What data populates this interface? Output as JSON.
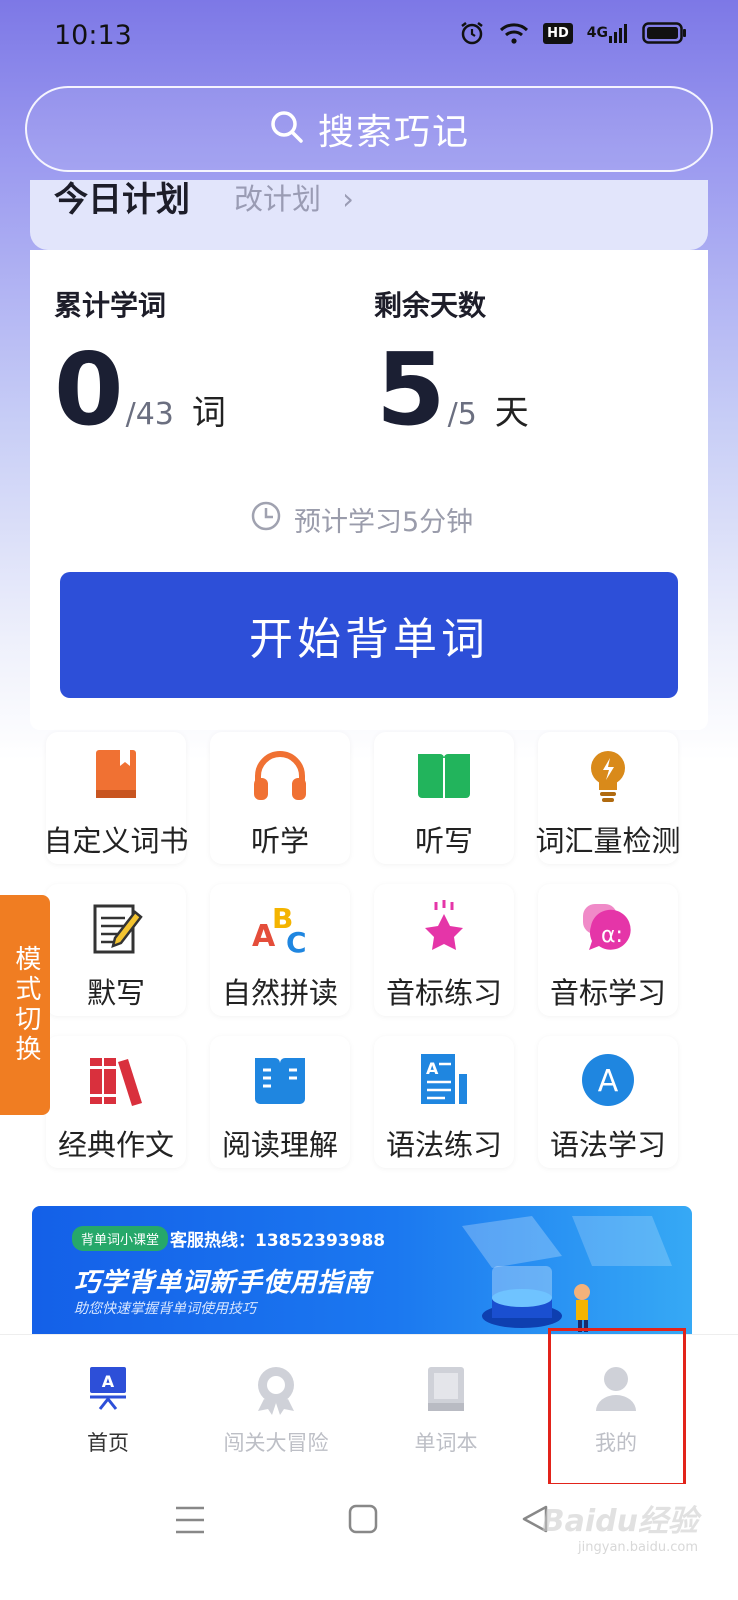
{
  "status_bar": {
    "time": "10:13",
    "hd_label": "HD",
    "network_label": "4G"
  },
  "search": {
    "placeholder": "搜索巧记"
  },
  "plan": {
    "title": "今日计划",
    "edit_label": "改计划"
  },
  "stats": {
    "words": {
      "label": "累计学词",
      "value": "0",
      "total": "/43",
      "unit": "词"
    },
    "days": {
      "label": "剩余天数",
      "value": "5",
      "total": "/5",
      "unit": "天"
    }
  },
  "eta_text": "预计学习5分钟",
  "start_button": "开始背单词",
  "features": [
    {
      "label": "自定义词书",
      "icon": "book-icon",
      "color": "#f07133"
    },
    {
      "label": "听学",
      "icon": "headphones-icon",
      "color": "#f07133"
    },
    {
      "label": "听写",
      "icon": "open-book-icon",
      "color": "#22b45c"
    },
    {
      "label": "词汇量检测",
      "icon": "lightbulb-icon",
      "color": "#d98a1a"
    },
    {
      "label": "默写",
      "icon": "notepad-pen-icon",
      "color": "#333333"
    },
    {
      "label": "自然拼读",
      "icon": "abc-blocks-icon",
      "color": "#e44d3a"
    },
    {
      "label": "音标练习",
      "icon": "star-icon",
      "color": "#e535a8"
    },
    {
      "label": "音标学习",
      "icon": "speech-bubble-icon",
      "color": "#e535a8"
    },
    {
      "label": "经典作文",
      "icon": "books-stack-icon",
      "color": "#d9303d"
    },
    {
      "label": "阅读理解",
      "icon": "reading-book-icon",
      "color": "#1f86e0"
    },
    {
      "label": "语法练习",
      "icon": "document-icon",
      "color": "#1f86e0"
    },
    {
      "label": "语法学习",
      "icon": "letter-a-icon",
      "color": "#1f86e0",
      "glyph": "A"
    }
  ],
  "mode_switch": "模式切换",
  "banner": {
    "tag": "背单词小课堂",
    "hotline": "客服热线：13852393988",
    "title": "巧学背单词新手使用指南",
    "subtitle": "助您快速掌握背单词使用技巧"
  },
  "bottom_nav": [
    {
      "label": "首页",
      "icon": "home-icon",
      "active": true,
      "glyph": "A"
    },
    {
      "label": "闯关大冒险",
      "icon": "medal-icon",
      "active": false
    },
    {
      "label": "单词本",
      "icon": "wordbook-icon",
      "active": false
    },
    {
      "label": "我的",
      "icon": "profile-icon",
      "active": false
    }
  ],
  "watermark": {
    "main": "Baidu经验",
    "sub": "jingyan.baidu.com"
  },
  "colors": {
    "primary": "#2d4fd8",
    "accent_orange": "#f07d22",
    "highlight_red": "#e2231a"
  }
}
